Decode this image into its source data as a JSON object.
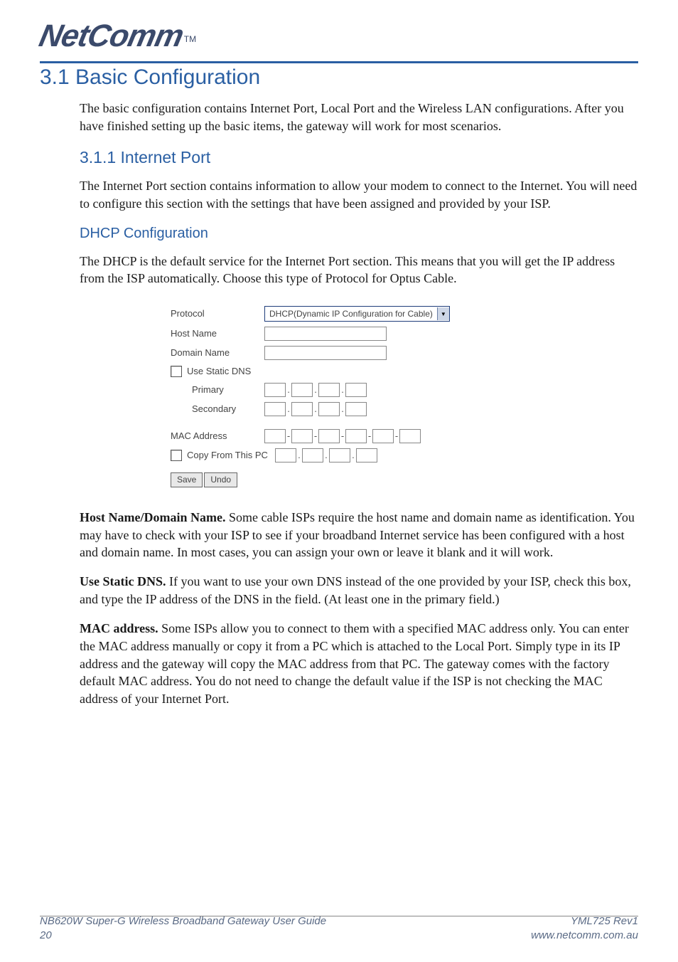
{
  "logo": {
    "text": "NetComm",
    "tm": "TM"
  },
  "h1": "3.1  Basic Configuration",
  "intro": "The basic configuration contains Internet Port, Local Port and the Wireless LAN configurations. After you have finished setting up the basic items, the gateway will work for most scenarios.",
  "h2": "3.1.1 Internet Port",
  "internet_para": "The Internet Port section contains information to allow your modem to connect to the Internet. You will need to configure this section with the settings that have been assigned and provided by your ISP.",
  "h3": "DHCP Configuration",
  "dhcp_para": "The DHCP is the default service for the Internet Port section.  This means that you will get the IP address from the ISP automatically.  Choose this type of Protocol for Optus Cable.",
  "form": {
    "protocol_label": "Protocol",
    "protocol_value": "DHCP(Dynamic IP Configuration for Cable)",
    "hostname_label": "Host Name",
    "domain_label": "Domain Name",
    "static_dns_label": "Use Static DNS",
    "primary_label": "Primary",
    "secondary_label": "Secondary",
    "mac_label": "MAC Address",
    "copy_label": "Copy From This PC",
    "save": "Save",
    "undo": "Undo"
  },
  "para_host_lead": "Host Name/Domain Name.",
  "para_host": " Some cable ISPs require the host name and domain name as identification.  You may have to check with your ISP to see if your broadband Internet service has been configured with a host and domain name. In most cases, you can assign your own or leave it blank and it will work.",
  "para_dns_lead": "Use Static DNS.",
  "para_dns": " If you want to use your own DNS instead of the one provided by your ISP, check this box, and type the IP address of the DNS in the field. (At least one in the primary field.)",
  "para_mac_lead": "MAC address.",
  "para_mac": " Some ISPs allow you to connect to them with a specified MAC address only. You can enter the MAC address manually or copy it from a PC which is attached to the Local Port.  Simply type in its IP address and the gateway will copy the MAC address from that PC. The gateway comes with the factory default MAC address.  You do not need to change the default value if the ISP is not checking the MAC address of your Internet Port.",
  "footer": {
    "title": "NB620W Super-G Wireless Broadband  Gateway User Guide",
    "page": "20",
    "rev": "YML725 Rev1",
    "url": "www.netcomm.com.au"
  }
}
